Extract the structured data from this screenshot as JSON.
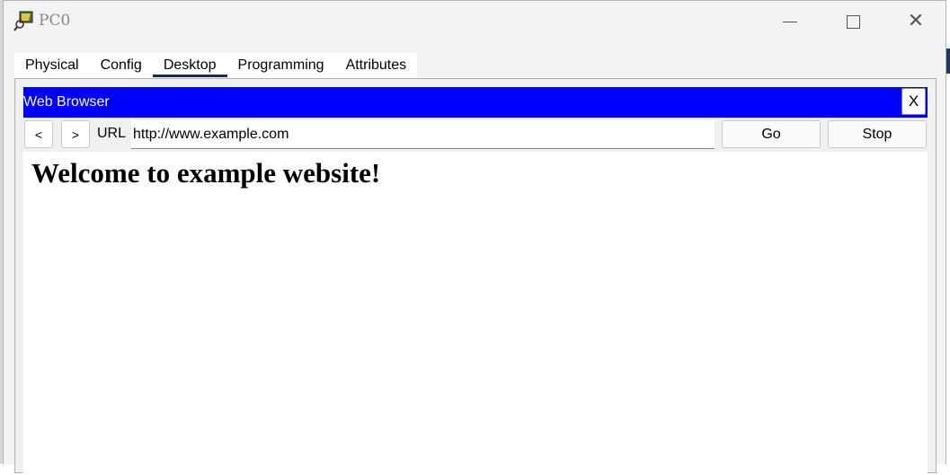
{
  "window": {
    "title": "PC0"
  },
  "tabs": [
    {
      "label": "Physical",
      "active": false
    },
    {
      "label": "Config",
      "active": false
    },
    {
      "label": "Desktop",
      "active": true
    },
    {
      "label": "Programming",
      "active": false
    },
    {
      "label": "Attributes",
      "active": false
    }
  ],
  "browser": {
    "title": "Web Browser",
    "close_label": "X",
    "back_label": "<",
    "forward_label": ">",
    "url_label": "URL",
    "url_value": "http://www.example.com",
    "go_label": "Go",
    "stop_label": "Stop",
    "header_color": "#0000ff"
  },
  "page": {
    "heading": "Welcome to example website!"
  },
  "icons": [
    "app-icon",
    "minimize-icon",
    "maximize-icon",
    "close-icon"
  ]
}
